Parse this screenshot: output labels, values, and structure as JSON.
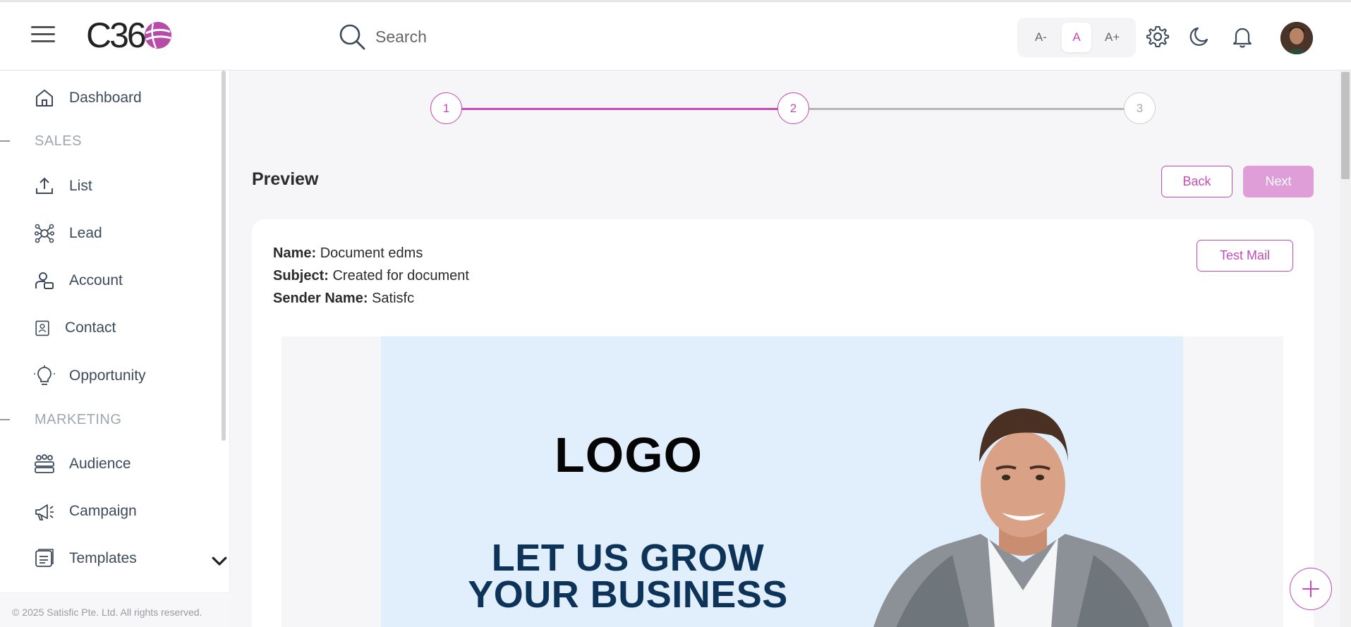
{
  "header": {
    "logo_text": "C36",
    "search_placeholder": "Search",
    "font_size": {
      "decrease": "A-",
      "normal": "A",
      "increase": "A+"
    }
  },
  "sidebar": {
    "items": [
      {
        "label": "Dashboard",
        "icon": "home-icon"
      },
      {
        "section": "SALES"
      },
      {
        "label": "List",
        "icon": "upload-icon"
      },
      {
        "label": "Lead",
        "icon": "network-icon"
      },
      {
        "label": "Account",
        "icon": "user-card-icon"
      },
      {
        "label": "Contact",
        "icon": "contact-book-icon"
      },
      {
        "label": "Opportunity",
        "icon": "lightbulb-icon"
      },
      {
        "section": "MARKETING"
      },
      {
        "label": "Audience",
        "icon": "group-icon"
      },
      {
        "label": "Campaign",
        "icon": "megaphone-icon"
      },
      {
        "label": "Templates",
        "icon": "template-icon"
      }
    ],
    "footer": "© 2025 Satisfic Pte. Ltd. All rights reserved."
  },
  "stepper": {
    "steps": [
      "1",
      "2",
      "3"
    ],
    "current": 2
  },
  "main": {
    "title": "Preview",
    "back_label": "Back",
    "next_label": "Next",
    "test_mail_label": "Test Mail",
    "name_label": "Name:",
    "name_value": "Document edms",
    "subject_label": "Subject:",
    "subject_value": "Created for document",
    "sender_label": "Sender Name:",
    "sender_value": "Satisfc",
    "email": {
      "logo": "LOGO",
      "headline_line1": "LET US GROW",
      "headline_line2": "YOUR BUSINESS"
    }
  },
  "colors": {
    "accent": "#c44bb8",
    "next_disabled": "#e09ed9",
    "email_bg": "#e0effb",
    "headline": "#0e3358"
  }
}
